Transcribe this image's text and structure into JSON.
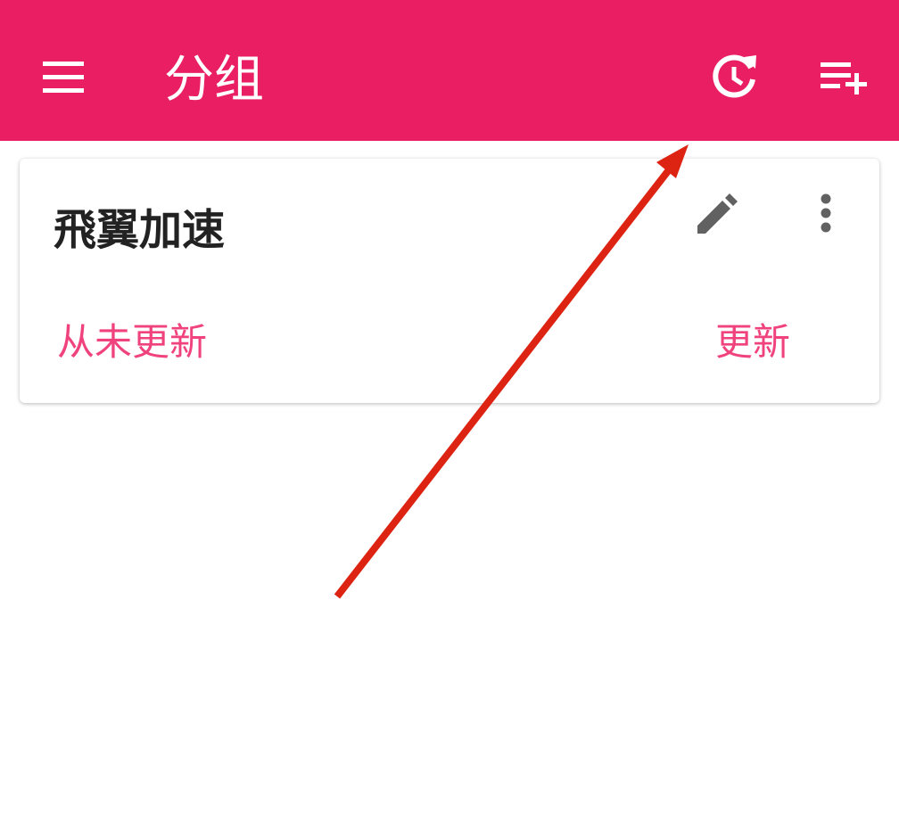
{
  "colors": {
    "accent": "#e91e63",
    "accent_text": "#f0427c",
    "arrow": "#dd2312",
    "icon_gray": "#616161"
  },
  "appbar": {
    "title": "分组",
    "menu_icon": "menu-icon",
    "history_icon": "update-history-icon",
    "add_icon": "playlist-add-icon"
  },
  "group_card": {
    "name": "飛翼加速",
    "status": "从未更新",
    "update_label": "更新",
    "edit_icon": "pencil-icon",
    "more_icon": "more-vert-icon"
  }
}
